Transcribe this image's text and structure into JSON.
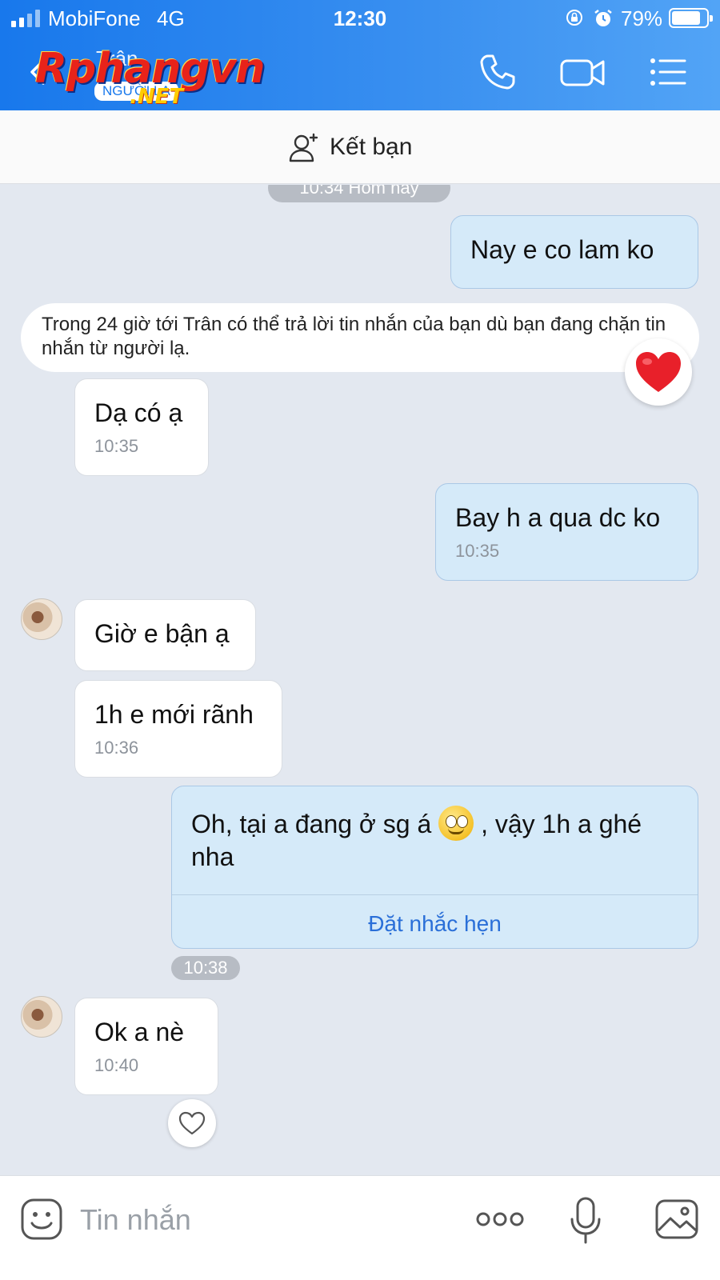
{
  "status_bar": {
    "carrier": "MobiFone",
    "network": "4G",
    "time": "12:30",
    "battery_percent": "79%",
    "battery_level": 0.79
  },
  "header": {
    "contact_name": "Trân",
    "contact_subtitle": "NGƯỜI LẠ",
    "watermark_main": "Rphangvn",
    "watermark_suffix": ".NET",
    "icons": [
      "back-icon",
      "phone-icon",
      "video-call-icon",
      "menu-list-icon"
    ],
    "accent_color": "#1878ec"
  },
  "friend_bar": {
    "label": "Kết bạn",
    "icon": "add-user-icon"
  },
  "chat": {
    "top_time_pill": "10:34 Hôm nay",
    "notice": "Trong 24 giờ tới Trân có thể trả lời tin nhắn của bạn dù bạn đang chặn tin nhắn từ người lạ.",
    "messages": [
      {
        "id": "m1",
        "direction": "out",
        "text": "Nay e co lam ko",
        "time": ""
      },
      {
        "id": "m2",
        "direction": "in",
        "text": "Dạ có ạ",
        "time": "10:35"
      },
      {
        "id": "m3",
        "direction": "out",
        "text": "Bay h a qua dc ko",
        "time": "10:35"
      },
      {
        "id": "m4",
        "direction": "in",
        "text": "Giờ e bận ạ",
        "time": ""
      },
      {
        "id": "m5",
        "direction": "in",
        "text": "1h e mới rãnh",
        "time": "10:36"
      },
      {
        "id": "m6",
        "direction": "out",
        "text_before": "Oh, tại a đang ở sg á",
        "text_after": ", vậy 1h a ghé nha",
        "emoji": "smiley-emoji",
        "action": "Đặt nhắc hẹn"
      },
      {
        "id": "m7",
        "direction": "in",
        "text": "Ok a nè",
        "time": "10:40"
      }
    ],
    "mid_time_pill": "10:38",
    "reactions": {
      "notice_reaction": "heart-icon",
      "last_message_reaction": "heart-outline-icon"
    },
    "colors": {
      "outgoing_bubble": "#d5eaf9",
      "incoming_bubble": "#ffffff",
      "background": "#e3e8f0",
      "link": "#2a6fd8"
    }
  },
  "input_bar": {
    "placeholder": "Tin nhắn",
    "icons": [
      "emoji-icon",
      "more-icon",
      "microphone-icon",
      "image-icon"
    ]
  }
}
